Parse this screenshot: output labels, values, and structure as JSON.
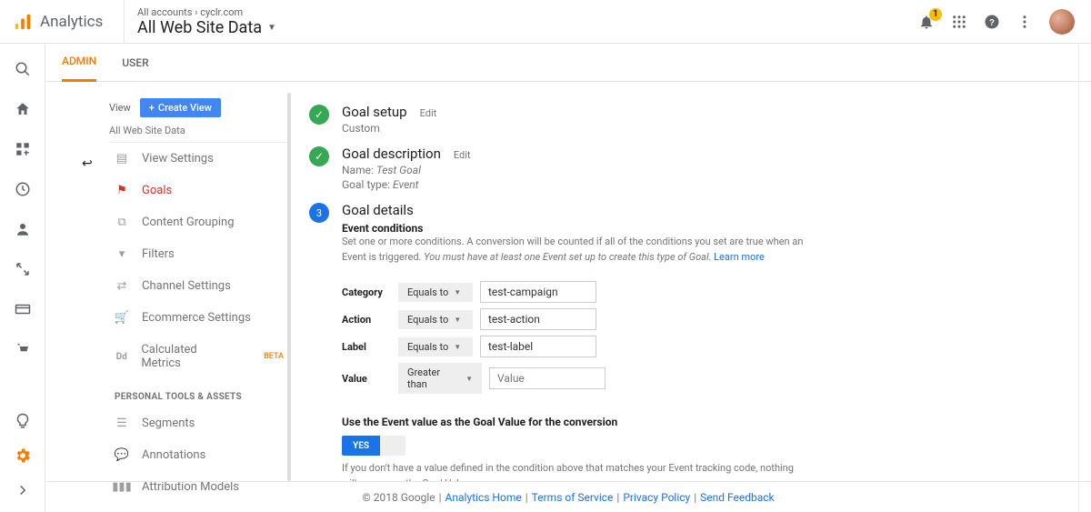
{
  "header": {
    "product": "Analytics",
    "breadcrumb_prefix": "All accounts",
    "breadcrumb_account": "cyclr.com",
    "title": "All Web Site Data",
    "notif_count": "1"
  },
  "tabs": {
    "admin": "ADMIN",
    "user": "USER"
  },
  "view_panel": {
    "label": "View",
    "create_btn": "Create View",
    "name": "All Web Site Data",
    "items": [
      "View Settings",
      "Goals",
      "Content Grouping",
      "Filters",
      "Channel Settings",
      "Ecommerce Settings",
      "Calculated Metrics"
    ],
    "beta": "BETA",
    "section": "PERSONAL TOOLS & ASSETS",
    "personal": [
      "Segments",
      "Annotations",
      "Attribution Models"
    ]
  },
  "goal": {
    "step1_title": "Goal setup",
    "step1_sub": "Custom",
    "step2_title": "Goal description",
    "step2_name_label": "Name:",
    "step2_name_value": "Test Goal",
    "step2_type_label": "Goal type:",
    "step2_type_value": "Event",
    "step3_num": "3",
    "step3_title": "Goal details",
    "edit": "Edit",
    "ec_heading": "Event conditions",
    "ec_help_1": "Set one or more conditions. A conversion will be counted if all of the conditions you set are true when an Event is triggered.",
    "ec_help_2": "You must have at least one Event set up to create this type of Goal.",
    "learn_more": "Learn more",
    "conds": {
      "category": {
        "label": "Category",
        "op": "Equals to",
        "value": "test-campaign"
      },
      "action": {
        "label": "Action",
        "op": "Equals to",
        "value": "test-action"
      },
      "label": {
        "label": "Label",
        "op": "Equals to",
        "value": "test-label"
      },
      "value": {
        "label": "Value",
        "op": "Greater than",
        "placeholder": "Value"
      }
    },
    "toggle_heading": "Use the Event value as the Goal Value for the conversion",
    "toggle_on": "YES",
    "toggle_help": "If you don't have a value defined in the condition above that matches your Event tracking code, nothing will appear as the Goal Value."
  },
  "footer": {
    "copyright": "© 2018 Google",
    "links": [
      "Analytics Home",
      "Terms of Service",
      "Privacy Policy",
      "Send Feedback"
    ]
  }
}
